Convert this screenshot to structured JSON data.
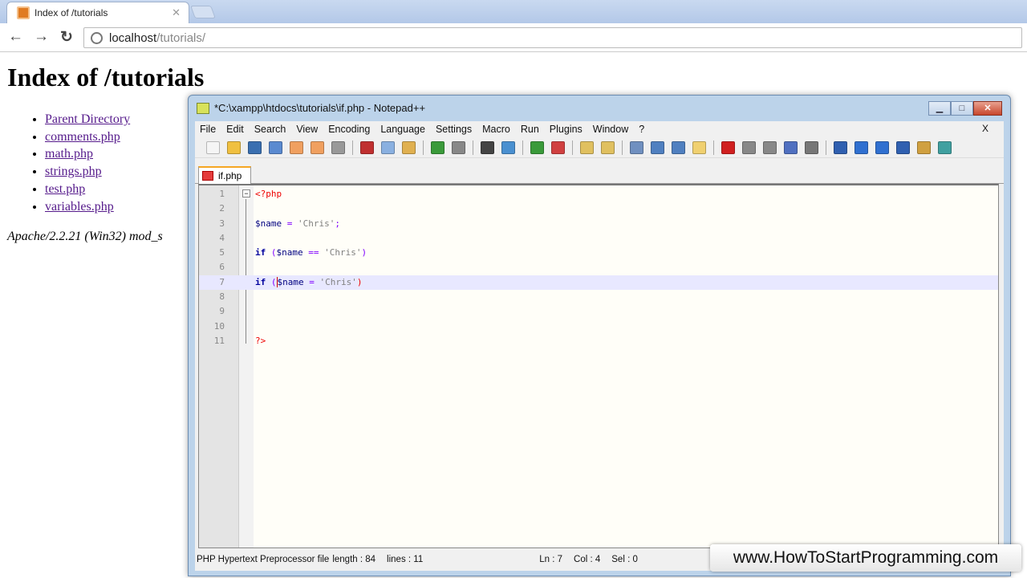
{
  "browser": {
    "tab_title": "Index of /tutorials",
    "url_host": "localhost",
    "url_path": "/tutorials/"
  },
  "page": {
    "heading": "Index of /tutorials",
    "links": [
      "Parent Directory",
      "comments.php",
      "math.php",
      "strings.php",
      "test.php",
      "variables.php"
    ],
    "footer": "Apache/2.2.21 (Win32) mod_s"
  },
  "npp": {
    "title": "*C:\\xampp\\htdocs\\tutorials\\if.php - Notepad++",
    "menu": [
      "File",
      "Edit",
      "Search",
      "View",
      "Encoding",
      "Language",
      "Settings",
      "Macro",
      "Run",
      "Plugins",
      "Window",
      "?"
    ],
    "menu_close": "X",
    "tab": "if.php",
    "lines": [
      {
        "n": "1"
      },
      {
        "n": "2"
      },
      {
        "n": "3"
      },
      {
        "n": "4"
      },
      {
        "n": "5"
      },
      {
        "n": "6"
      },
      {
        "n": "7"
      },
      {
        "n": "8"
      },
      {
        "n": "9"
      },
      {
        "n": "10"
      },
      {
        "n": "11"
      }
    ],
    "code": {
      "l1": "<?php",
      "l3_var": "$name",
      "l3_op": " = ",
      "l3_str": "'Chris'",
      "l3_end": ";",
      "l5_kw": "if",
      "l5_a": " (",
      "l5_var": "$name",
      "l5_op": " == ",
      "l5_str": "'Chris'",
      "l5_b": ")",
      "l7_kw": "if",
      "l7_a": " (",
      "l7_var": "$name",
      "l7_op": " = ",
      "l7_str": "'Chris'",
      "l7_b": ")",
      "l11": "?>"
    },
    "status": {
      "type": "PHP Hypertext Preprocessor file",
      "length": "length : 84",
      "lines": "lines : 11",
      "ln": "Ln : 7",
      "col": "Col : 4",
      "sel": "Sel : 0"
    }
  },
  "watermark": "www.HowToStartProgramming.com",
  "toolbar_icons": [
    "new-file",
    "open",
    "save",
    "save-all",
    "close",
    "close-all",
    "print",
    "cut",
    "copy",
    "paste",
    "undo",
    "redo",
    "find",
    "replace",
    "zoom-in",
    "zoom-out",
    "sync-v",
    "sync-h",
    "wrap",
    "all-chars",
    "indent-guide",
    "udl",
    "record",
    "stop",
    "play",
    "play-multi",
    "save-macro",
    "fold",
    "up",
    "down",
    "summary",
    "monitor",
    "spell"
  ]
}
